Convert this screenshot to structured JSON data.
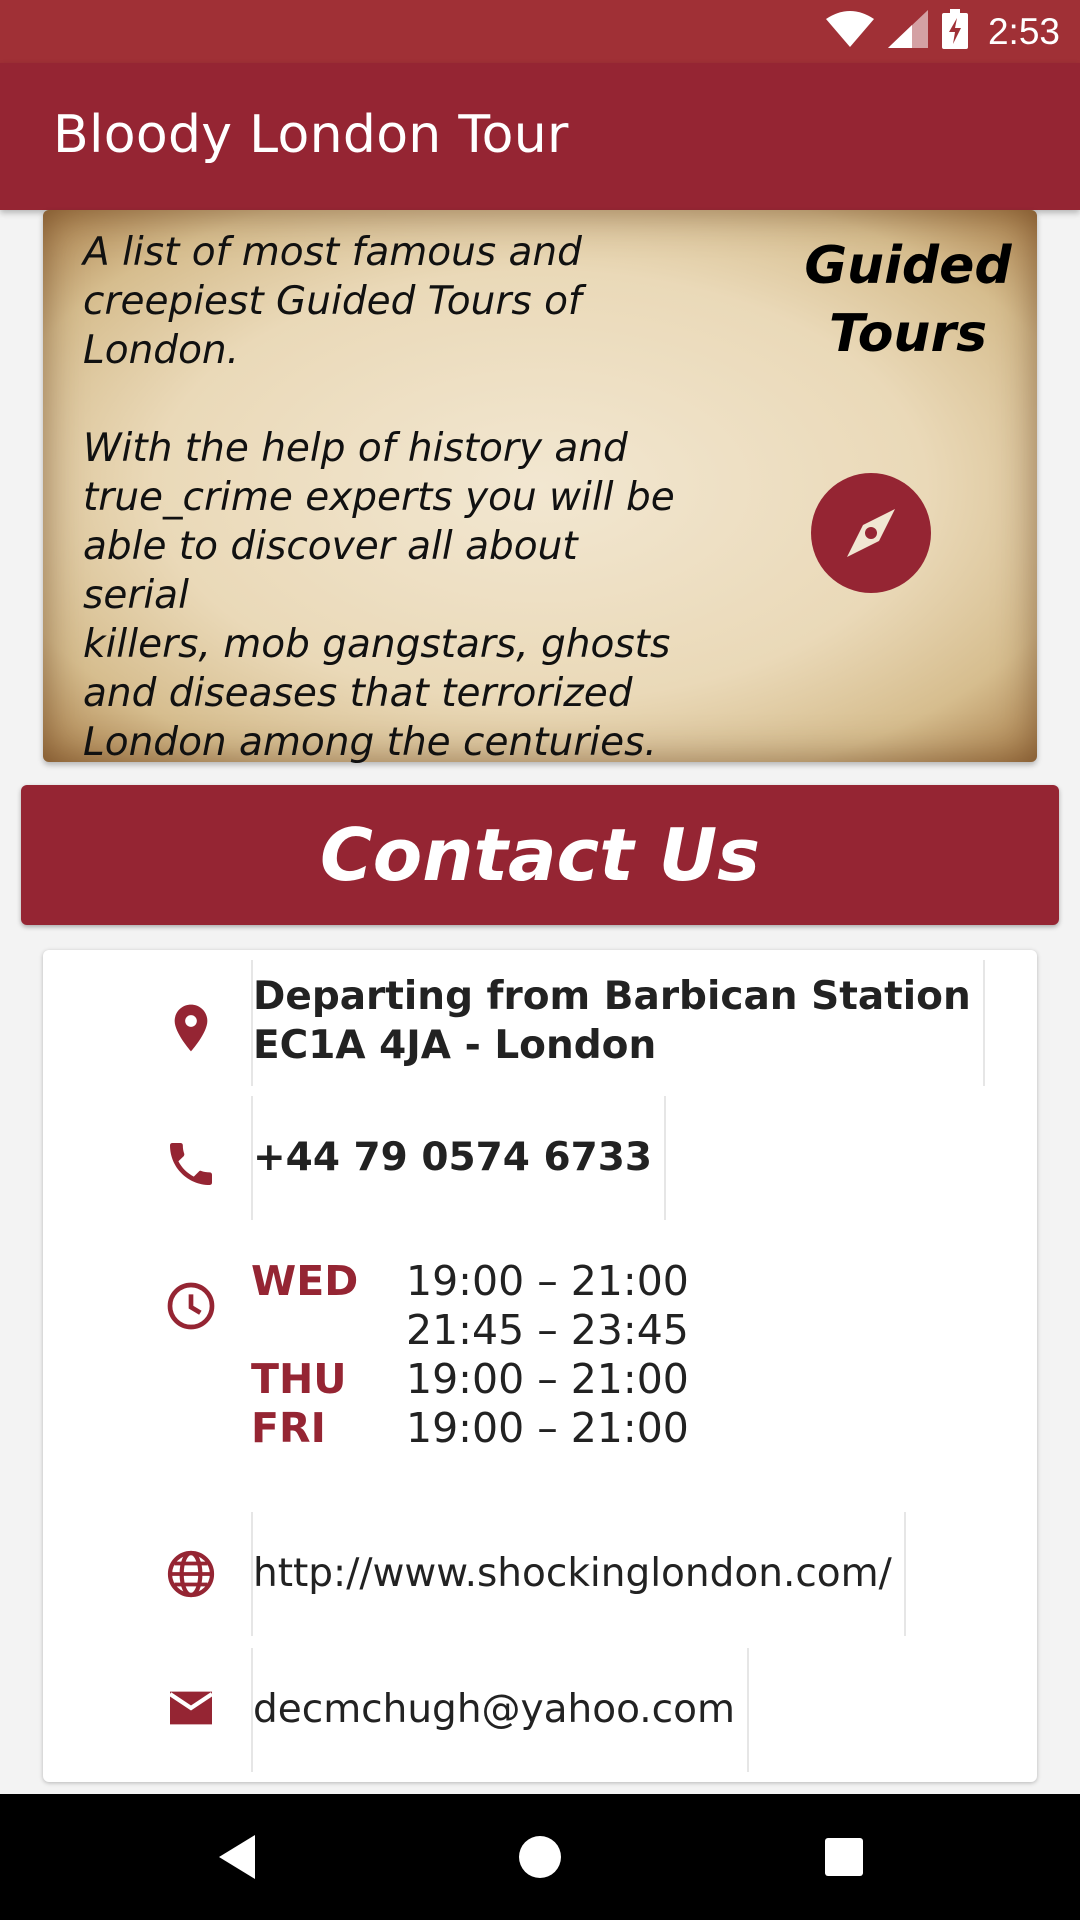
{
  "status_bar": {
    "time": "2:53"
  },
  "app_bar": {
    "title": "Bloody London Tour"
  },
  "intro": {
    "description": "A list of most famous and\ncreepiest Guided Tours of\nLondon.\n\nWith the help of history and\ntrue_crime experts you will be\nable to discover all about serial\nkillers, mob gangstars, ghosts\nand diseases that terrorized\nLondon among the centuries.",
    "section_title": "Guided\nTours",
    "icon": "compass-icon"
  },
  "contact": {
    "heading": "Contact Us",
    "address": "Departing from Barbican Station\nEC1A 4JA - London",
    "phone": "+44 79 0574 6733",
    "hours": [
      {
        "day": "WED",
        "time": "19:00 – 21:00"
      },
      {
        "day": "",
        "time": "21:45 – 23:45"
      },
      {
        "day": "THU",
        "time": "19:00 – 21:00"
      },
      {
        "day": "FRI",
        "time": "19:00 – 21:00"
      }
    ],
    "website": "http://www.shockinglondon.com/",
    "email": "decmchugh@yahoo.com"
  },
  "colors": {
    "primary": "#952533",
    "status_bar": "#a03036"
  }
}
